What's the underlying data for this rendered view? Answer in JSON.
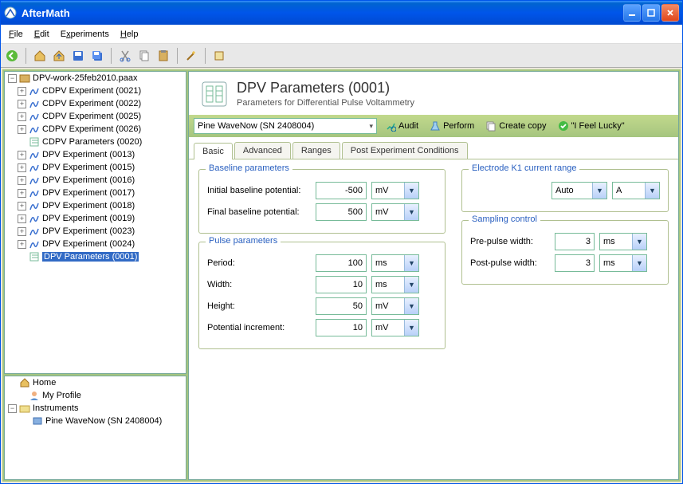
{
  "window": {
    "title": "AfterMath"
  },
  "menus": {
    "file": "File",
    "edit": "Edit",
    "experiments": "Experiments",
    "help": "Help"
  },
  "tree": {
    "root": "DPV-work-25feb2010.paax",
    "items": [
      "CDPV Experiment (0021)",
      "CDPV Experiment (0022)",
      "CDPV Experiment (0025)",
      "CDPV Experiment (0026)",
      "CDPV Parameters (0020)",
      "DPV Experiment (0013)",
      "DPV Experiment (0015)",
      "DPV Experiment (0016)",
      "DPV Experiment (0017)",
      "DPV Experiment (0018)",
      "DPV Experiment (0019)",
      "DPV Experiment (0023)",
      "DPV Experiment (0024)",
      "DPV Parameters (0001)"
    ]
  },
  "lower_tree": {
    "home": "Home",
    "profile": "My Profile",
    "instruments": "Instruments",
    "device": "Pine WaveNow (SN 2408004)"
  },
  "header": {
    "title": "DPV Parameters (0001)",
    "subtitle": "Parameters for Differential Pulse Voltammetry"
  },
  "instrument": "Pine WaveNow (SN 2408004)",
  "actions": {
    "audit": "Audit",
    "perform": "Perform",
    "copy": "Create copy",
    "lucky": "\"I Feel Lucky\""
  },
  "tabs": {
    "basic": "Basic",
    "advanced": "Advanced",
    "ranges": "Ranges",
    "post": "Post Experiment Conditions"
  },
  "groups": {
    "baseline": "Baseline parameters",
    "pulse": "Pulse parameters",
    "k1": "Electrode K1 current range",
    "sampling": "Sampling control"
  },
  "labels": {
    "init_baseline": "Initial baseline potential:",
    "final_baseline": "Final baseline potential:",
    "period": "Period:",
    "width": "Width:",
    "height": "Height:",
    "pinc": "Potential increment:",
    "prepulse": "Pre-pulse width:",
    "postpulse": "Post-pulse width:"
  },
  "values": {
    "init_baseline": "-500",
    "final_baseline": "500",
    "period": "100",
    "width": "10",
    "height": "50",
    "pinc": "10",
    "k1_mode": "Auto",
    "k1_unit": "A",
    "prepulse": "3",
    "postpulse": "3"
  },
  "units": {
    "mV": "mV",
    "ms": "ms"
  }
}
